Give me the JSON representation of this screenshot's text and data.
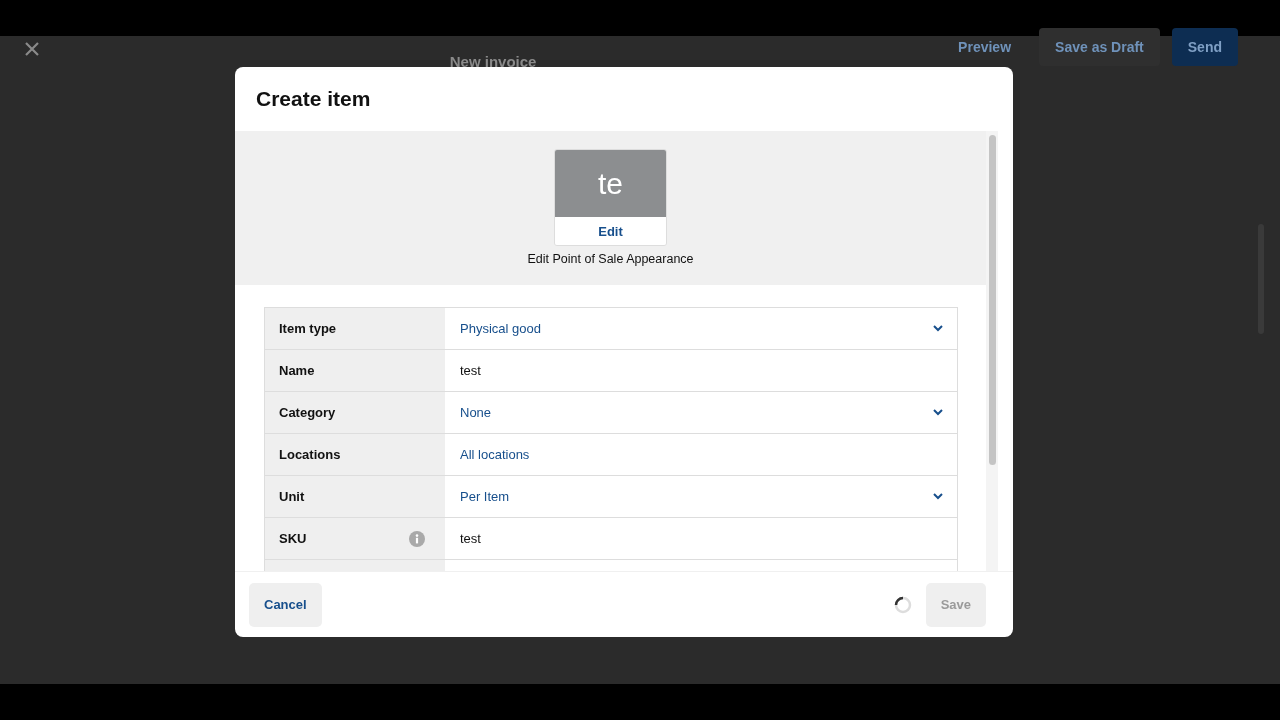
{
  "page": {
    "title": "New invoice",
    "actions": [
      {
        "label": "Preview",
        "kind": "link"
      },
      {
        "label": "Save as Draft",
        "kind": "secondary"
      },
      {
        "label": "Send",
        "kind": "primary"
      }
    ]
  },
  "dialog": {
    "title": "Create item",
    "thumbnail": {
      "initials": "te",
      "edit": "Edit",
      "caption": "Edit Point of Sale Appearance"
    },
    "fields": [
      {
        "label": "Item type",
        "value": "Physical good",
        "kind": "select",
        "info": false
      },
      {
        "label": "Name",
        "value": "test",
        "kind": "text",
        "info": false
      },
      {
        "label": "Category",
        "value": "None",
        "kind": "select",
        "info": false
      },
      {
        "label": "Locations",
        "value": "All locations",
        "kind": "link",
        "info": false
      },
      {
        "label": "Unit",
        "value": "Per Item",
        "kind": "select",
        "info": false
      },
      {
        "label": "SKU",
        "value": "test",
        "kind": "text",
        "info": true
      }
    ],
    "cancel": "Cancel",
    "save": {
      "label": "Save",
      "disabled": true
    },
    "loading": true
  }
}
